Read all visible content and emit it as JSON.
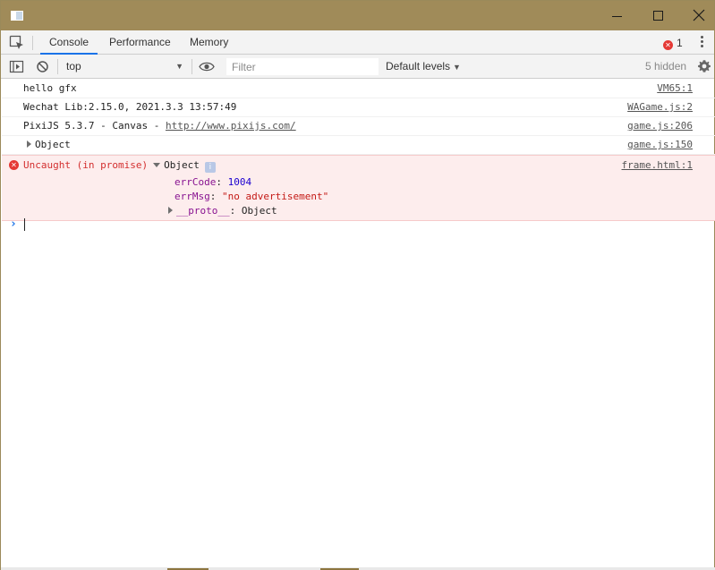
{
  "window": {
    "title_icon": "app-window-icon",
    "controls": {
      "minimize_icon": "minimize-icon",
      "maximize_icon": "maximize-icon",
      "close_icon": "close-icon"
    },
    "titlebar_color": "#a08b59"
  },
  "tabs": [
    {
      "label": "Console",
      "active": true
    },
    {
      "label": "Performance",
      "active": false
    },
    {
      "label": "Memory",
      "active": false
    }
  ],
  "error_badge": {
    "count": "1",
    "icon": "error-icon"
  },
  "toolbar": {
    "context": "top",
    "filter_placeholder": "Filter",
    "levels_label": "Default levels",
    "hidden_label": "5 hidden"
  },
  "messages": [
    {
      "text": "hello gfx",
      "source": "VM65:1"
    },
    {
      "text": "Wechat Lib:2.15.0, 2021.3.3 13:57:49",
      "source": "WAGame.js:2"
    },
    {
      "text_prefix": "PixiJS 5.3.7 - Canvas - ",
      "link": "http://www.pixijs.com/",
      "source": "game.js:206"
    },
    {
      "text": "Object",
      "source": "game.js:150"
    }
  ],
  "error": {
    "label": "Uncaught (in promise)",
    "object_label": "Object",
    "info_badge": "i",
    "source": "frame.html:1",
    "props": [
      {
        "key": "errCode",
        "value": "1004"
      },
      {
        "key": "errMsg",
        "value": "\"no advertisement\""
      }
    ],
    "proto_key": "__proto__",
    "proto_value": "Object"
  },
  "colors": {
    "accent": "#1a73e8",
    "error": "#d32f2f",
    "error_bg": "#fdeded"
  }
}
